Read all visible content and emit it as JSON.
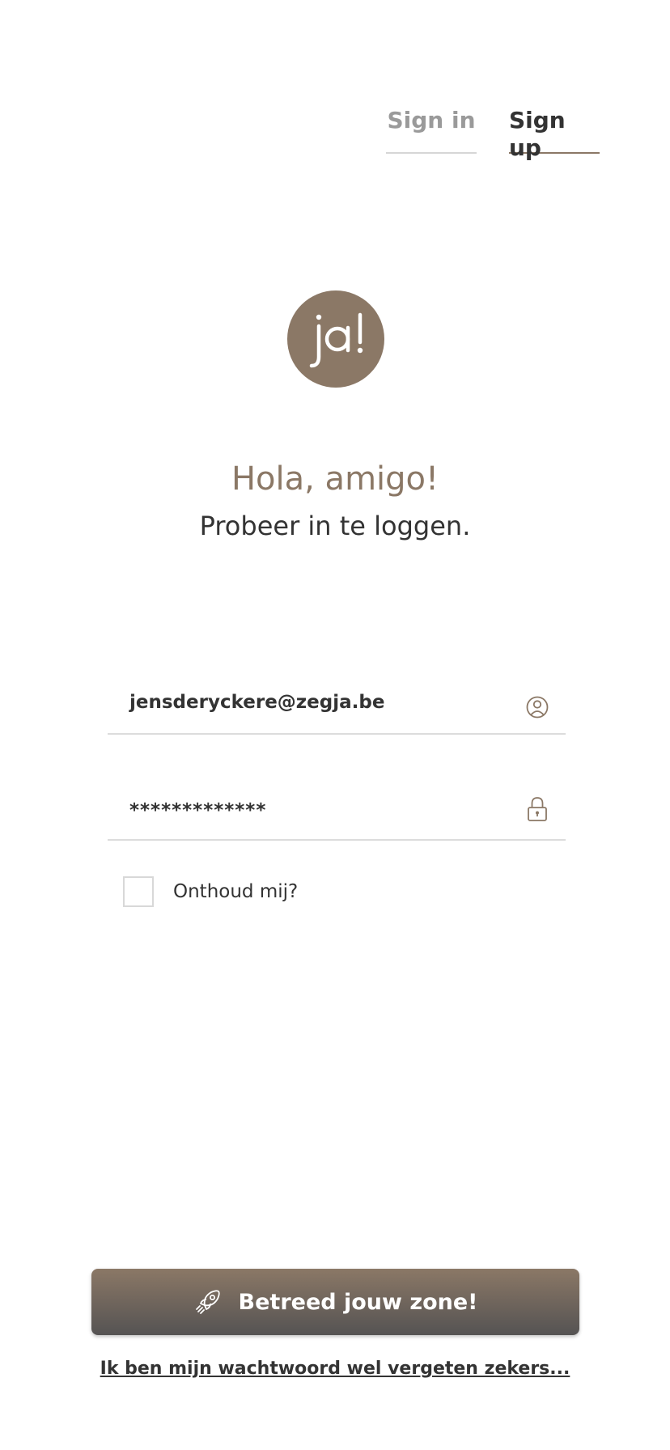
{
  "tabs": {
    "sign_in": "Sign in",
    "sign_up": "Sign up",
    "active": "sign_up"
  },
  "logo": {
    "text": "ja!",
    "icon": "ja-logo-icon"
  },
  "greeting": {
    "title": "Hola, amigo!",
    "subtitle": "Probeer in te loggen."
  },
  "login_form": {
    "email": {
      "value": "jensderyckere@zegja.be",
      "icon": "user-circle-icon"
    },
    "password": {
      "value": "*************",
      "icon": "padlock-icon"
    },
    "remember_me": {
      "label": "Onthoud mij?",
      "checked": false
    }
  },
  "submit": {
    "label": "Betreed jouw zone!",
    "icon": "rocket-icon"
  },
  "forgot_password_link": "Ik ben mijn wachtwoord wel vergeten zekers...",
  "colors": {
    "brand": "#8b7866",
    "button_gradient_start": "#8b7866",
    "button_gradient_end": "#555353",
    "text_primary": "#333333",
    "text_muted": "#9a9a9a"
  }
}
